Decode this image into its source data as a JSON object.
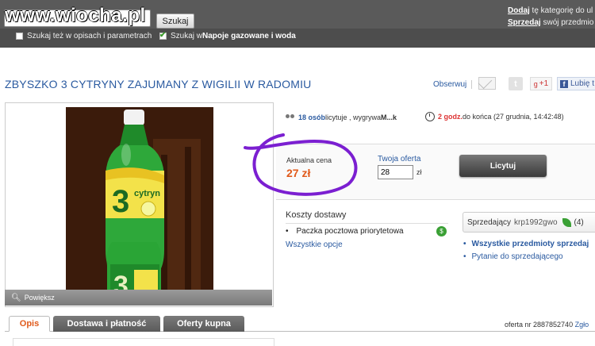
{
  "watermark": "www.wiocha.pl",
  "header": {
    "search_button": "Szukaj",
    "chk1_label": "Szukaj też w opisach i parametrach",
    "chk2_prefix": "Szukaj w ",
    "chk2_category": "Napoje gazowane i woda",
    "right_line1_link": "Dodaj",
    "right_line1_rest": " tę kategorię do ul",
    "right_line2_link": "Sprzedaj",
    "right_line2_rest": " swój przedmio"
  },
  "item": {
    "title": "ZBYSZKO 3 CYTRYNY ZAJUMANY Z WIGILII W RADOMIU",
    "obserwuj": "Obserwuj",
    "gplus": "+1",
    "fb_label": "Lubię t",
    "powieksz": "Powiększ"
  },
  "auction": {
    "bidders_count": "18 osób",
    "bidders_text": " licytuje , wygrywa ",
    "winner": "M...k",
    "time_left": "2 godz.",
    "time_text": " do końca (27 grudnia, 14:42:48)",
    "price_label": "Aktualna cena",
    "price_value": "27 zł",
    "offer_label": "Twoja oferta",
    "offer_value": "28",
    "offer_unit": "zł",
    "bid_button": "Licytuj"
  },
  "shipping": {
    "title": "Koszty dostawy",
    "item": "Paczka pocztowa priorytetowa",
    "all_options": "Wszystkie opcje"
  },
  "seller": {
    "label": "Sprzedający",
    "nick": "krp1992gwo",
    "rating": "(4)",
    "link_all": "Wszystkie przedmioty sprzedaj",
    "link_ask": "Pytanie do sprzedającego"
  },
  "tabs": [
    "Opis",
    "Dostawa i płatność",
    "Oferty kupna"
  ],
  "footer": {
    "offer_nr": "oferta nr 2887852740",
    "zglos": "Zgło"
  },
  "colors": {
    "accent_orange": "#e05a1b",
    "link_blue": "#2a5aa0",
    "annotation_purple": "#7b1fd1"
  }
}
